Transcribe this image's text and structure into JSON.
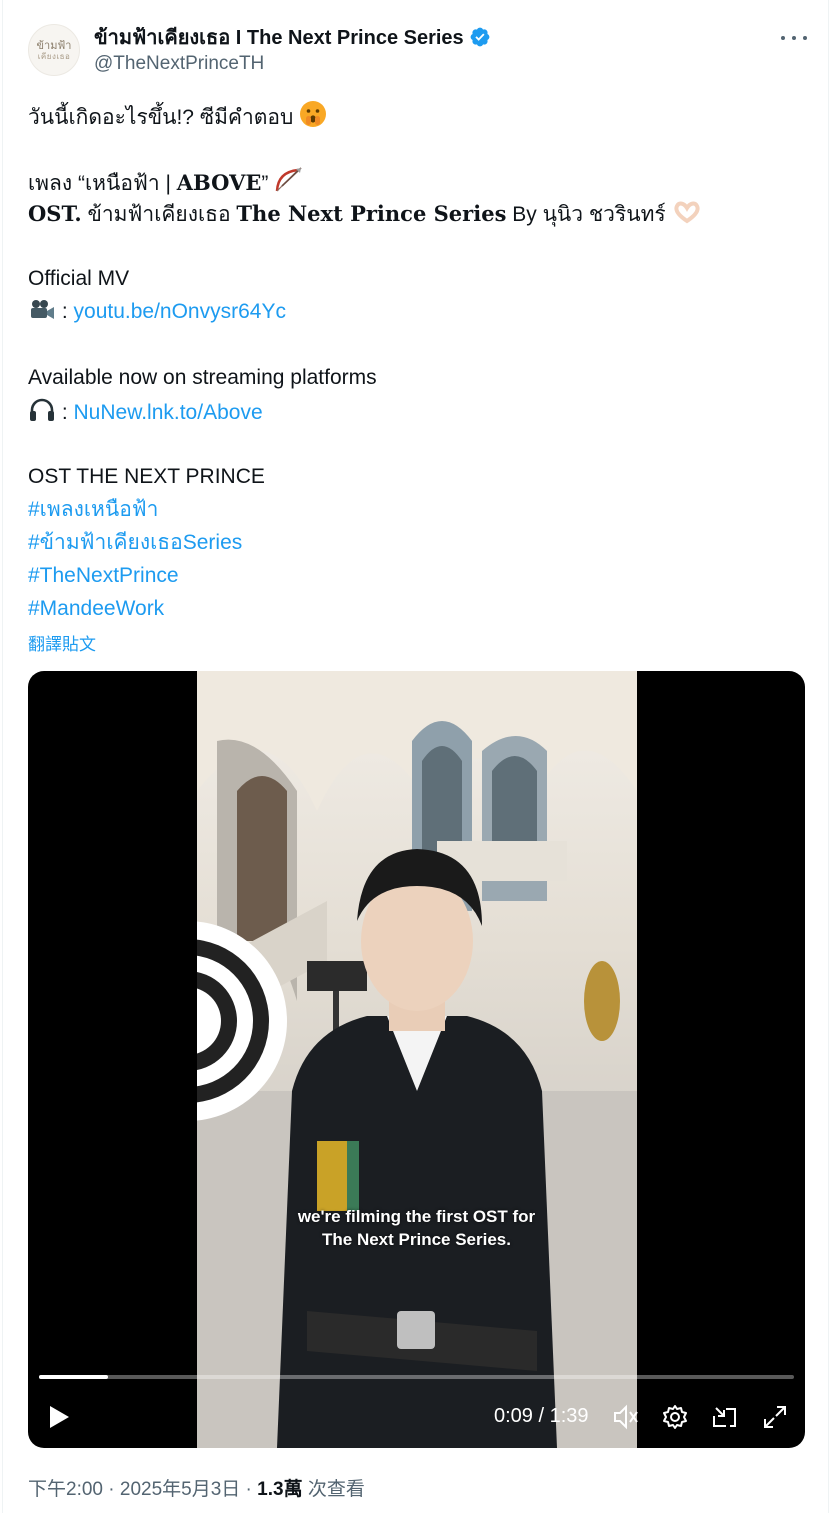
{
  "author": {
    "display_name": "ข้ามฟ้าเคียงเธอ I The Next Prince Series",
    "handle": "@TheNextPrinceTH",
    "avatar_text_1": "ข้ามฟ้า",
    "avatar_text_2": "เคียงเธอ",
    "verified_icon": "verified-badge-icon",
    "verified_color": "#1d9bf0"
  },
  "more_icon": "more-dots-icon",
  "post": {
    "line1": "วันนี้เกิดอะไรขึ้น!? ซีมีคำตอบ",
    "line1_emoji": "🫢",
    "line2_prefix": "เพลง “เหนือฟ้า | ",
    "line2_bold": "ABOVE",
    "line2_suffix": "”",
    "line2_emoji": "🏹",
    "line3_bold1": "OST.",
    "line3_mid": " ข้ามฟ้าเคียงเธอ ",
    "line3_bold2": "The Next Prince Series",
    "line3_end": " By นุนิว ชวรินทร์",
    "line3_emoji": "🫶",
    "mv_label": "Official MV",
    "mv_emoji": "🎥",
    "mv_sep": " : ",
    "mv_link": "youtu.be/nOnvysr64Yc",
    "streaming_label": "Available now on streaming platforms",
    "streaming_emoji": "🎧",
    "streaming_sep": " : ",
    "streaming_link": "NuNew.lnk.to/Above",
    "ost_label": "OST THE NEXT PRINCE",
    "hashtags": [
      "#เพลงเหนือฟ้า",
      "#ข้ามฟ้าเคียงเธอSeries",
      "#TheNextPrince",
      "#MandeeWork"
    ],
    "translate": "翻譯貼文"
  },
  "video": {
    "caption_line1": "we're filming the first OST for",
    "caption_line2": "The Next Prince Series.",
    "current_time": "0:09",
    "separator": " / ",
    "duration": "1:39",
    "progress_fraction": 0.0909,
    "icons": [
      "play-icon",
      "volume-icon",
      "settings-icon",
      "pip-icon",
      "fullscreen-icon"
    ]
  },
  "meta": {
    "time": "下午2:00",
    "dot1": " · ",
    "date": "2025年5月3日",
    "dot2": " · ",
    "views_count": "1.3萬",
    "views_label": " 次查看"
  },
  "colors": {
    "link": "#1d9bf0",
    "text": "#0f1419",
    "muted": "#536471"
  }
}
